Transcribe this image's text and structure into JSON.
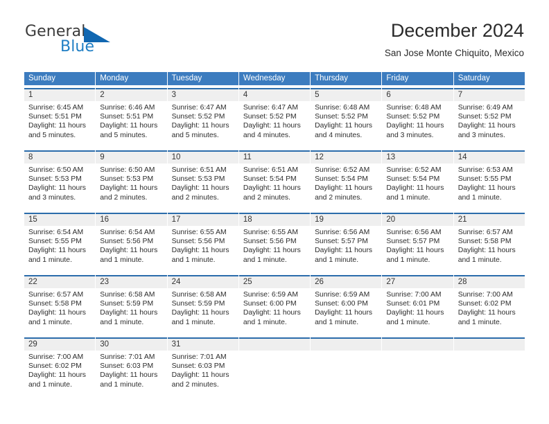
{
  "brand": {
    "name_part1": "General",
    "name_part2": "Blue",
    "triangle_color": "#1167b1",
    "blue_color": "#1f7ec4"
  },
  "header": {
    "title": "December 2024",
    "subtitle": "San Jose Monte Chiquito, Mexico"
  },
  "theme": {
    "header_blue": "#3c7cbf",
    "cell_border_blue": "#2b6cab",
    "daynum_band": "#efefef"
  },
  "weekday_headers": [
    "Sunday",
    "Monday",
    "Tuesday",
    "Wednesday",
    "Thursday",
    "Friday",
    "Saturday"
  ],
  "weeks": [
    [
      {
        "day": "1",
        "sunrise": "Sunrise: 6:45 AM",
        "sunset": "Sunset: 5:51 PM",
        "daylight_line1": "Daylight: 11 hours",
        "daylight_line2": "and 5 minutes."
      },
      {
        "day": "2",
        "sunrise": "Sunrise: 6:46 AM",
        "sunset": "Sunset: 5:51 PM",
        "daylight_line1": "Daylight: 11 hours",
        "daylight_line2": "and 5 minutes."
      },
      {
        "day": "3",
        "sunrise": "Sunrise: 6:47 AM",
        "sunset": "Sunset: 5:52 PM",
        "daylight_line1": "Daylight: 11 hours",
        "daylight_line2": "and 5 minutes."
      },
      {
        "day": "4",
        "sunrise": "Sunrise: 6:47 AM",
        "sunset": "Sunset: 5:52 PM",
        "daylight_line1": "Daylight: 11 hours",
        "daylight_line2": "and 4 minutes."
      },
      {
        "day": "5",
        "sunrise": "Sunrise: 6:48 AM",
        "sunset": "Sunset: 5:52 PM",
        "daylight_line1": "Daylight: 11 hours",
        "daylight_line2": "and 4 minutes."
      },
      {
        "day": "6",
        "sunrise": "Sunrise: 6:48 AM",
        "sunset": "Sunset: 5:52 PM",
        "daylight_line1": "Daylight: 11 hours",
        "daylight_line2": "and 3 minutes."
      },
      {
        "day": "7",
        "sunrise": "Sunrise: 6:49 AM",
        "sunset": "Sunset: 5:52 PM",
        "daylight_line1": "Daylight: 11 hours",
        "daylight_line2": "and 3 minutes."
      }
    ],
    [
      {
        "day": "8",
        "sunrise": "Sunrise: 6:50 AM",
        "sunset": "Sunset: 5:53 PM",
        "daylight_line1": "Daylight: 11 hours",
        "daylight_line2": "and 3 minutes."
      },
      {
        "day": "9",
        "sunrise": "Sunrise: 6:50 AM",
        "sunset": "Sunset: 5:53 PM",
        "daylight_line1": "Daylight: 11 hours",
        "daylight_line2": "and 2 minutes."
      },
      {
        "day": "10",
        "sunrise": "Sunrise: 6:51 AM",
        "sunset": "Sunset: 5:53 PM",
        "daylight_line1": "Daylight: 11 hours",
        "daylight_line2": "and 2 minutes."
      },
      {
        "day": "11",
        "sunrise": "Sunrise: 6:51 AM",
        "sunset": "Sunset: 5:54 PM",
        "daylight_line1": "Daylight: 11 hours",
        "daylight_line2": "and 2 minutes."
      },
      {
        "day": "12",
        "sunrise": "Sunrise: 6:52 AM",
        "sunset": "Sunset: 5:54 PM",
        "daylight_line1": "Daylight: 11 hours",
        "daylight_line2": "and 2 minutes."
      },
      {
        "day": "13",
        "sunrise": "Sunrise: 6:52 AM",
        "sunset": "Sunset: 5:54 PM",
        "daylight_line1": "Daylight: 11 hours",
        "daylight_line2": "and 1 minute."
      },
      {
        "day": "14",
        "sunrise": "Sunrise: 6:53 AM",
        "sunset": "Sunset: 5:55 PM",
        "daylight_line1": "Daylight: 11 hours",
        "daylight_line2": "and 1 minute."
      }
    ],
    [
      {
        "day": "15",
        "sunrise": "Sunrise: 6:54 AM",
        "sunset": "Sunset: 5:55 PM",
        "daylight_line1": "Daylight: 11 hours",
        "daylight_line2": "and 1 minute."
      },
      {
        "day": "16",
        "sunrise": "Sunrise: 6:54 AM",
        "sunset": "Sunset: 5:56 PM",
        "daylight_line1": "Daylight: 11 hours",
        "daylight_line2": "and 1 minute."
      },
      {
        "day": "17",
        "sunrise": "Sunrise: 6:55 AM",
        "sunset": "Sunset: 5:56 PM",
        "daylight_line1": "Daylight: 11 hours",
        "daylight_line2": "and 1 minute."
      },
      {
        "day": "18",
        "sunrise": "Sunrise: 6:55 AM",
        "sunset": "Sunset: 5:56 PM",
        "daylight_line1": "Daylight: 11 hours",
        "daylight_line2": "and 1 minute."
      },
      {
        "day": "19",
        "sunrise": "Sunrise: 6:56 AM",
        "sunset": "Sunset: 5:57 PM",
        "daylight_line1": "Daylight: 11 hours",
        "daylight_line2": "and 1 minute."
      },
      {
        "day": "20",
        "sunrise": "Sunrise: 6:56 AM",
        "sunset": "Sunset: 5:57 PM",
        "daylight_line1": "Daylight: 11 hours",
        "daylight_line2": "and 1 minute."
      },
      {
        "day": "21",
        "sunrise": "Sunrise: 6:57 AM",
        "sunset": "Sunset: 5:58 PM",
        "daylight_line1": "Daylight: 11 hours",
        "daylight_line2": "and 1 minute."
      }
    ],
    [
      {
        "day": "22",
        "sunrise": "Sunrise: 6:57 AM",
        "sunset": "Sunset: 5:58 PM",
        "daylight_line1": "Daylight: 11 hours",
        "daylight_line2": "and 1 minute."
      },
      {
        "day": "23",
        "sunrise": "Sunrise: 6:58 AM",
        "sunset": "Sunset: 5:59 PM",
        "daylight_line1": "Daylight: 11 hours",
        "daylight_line2": "and 1 minute."
      },
      {
        "day": "24",
        "sunrise": "Sunrise: 6:58 AM",
        "sunset": "Sunset: 5:59 PM",
        "daylight_line1": "Daylight: 11 hours",
        "daylight_line2": "and 1 minute."
      },
      {
        "day": "25",
        "sunrise": "Sunrise: 6:59 AM",
        "sunset": "Sunset: 6:00 PM",
        "daylight_line1": "Daylight: 11 hours",
        "daylight_line2": "and 1 minute."
      },
      {
        "day": "26",
        "sunrise": "Sunrise: 6:59 AM",
        "sunset": "Sunset: 6:00 PM",
        "daylight_line1": "Daylight: 11 hours",
        "daylight_line2": "and 1 minute."
      },
      {
        "day": "27",
        "sunrise": "Sunrise: 7:00 AM",
        "sunset": "Sunset: 6:01 PM",
        "daylight_line1": "Daylight: 11 hours",
        "daylight_line2": "and 1 minute."
      },
      {
        "day": "28",
        "sunrise": "Sunrise: 7:00 AM",
        "sunset": "Sunset: 6:02 PM",
        "daylight_line1": "Daylight: 11 hours",
        "daylight_line2": "and 1 minute."
      }
    ],
    [
      {
        "day": "29",
        "sunrise": "Sunrise: 7:00 AM",
        "sunset": "Sunset: 6:02 PM",
        "daylight_line1": "Daylight: 11 hours",
        "daylight_line2": "and 1 minute."
      },
      {
        "day": "30",
        "sunrise": "Sunrise: 7:01 AM",
        "sunset": "Sunset: 6:03 PM",
        "daylight_line1": "Daylight: 11 hours",
        "daylight_line2": "and 1 minute."
      },
      {
        "day": "31",
        "sunrise": "Sunrise: 7:01 AM",
        "sunset": "Sunset: 6:03 PM",
        "daylight_line1": "Daylight: 11 hours",
        "daylight_line2": "and 2 minutes."
      },
      {
        "day": "",
        "sunrise": "",
        "sunset": "",
        "daylight_line1": "",
        "daylight_line2": ""
      },
      {
        "day": "",
        "sunrise": "",
        "sunset": "",
        "daylight_line1": "",
        "daylight_line2": ""
      },
      {
        "day": "",
        "sunrise": "",
        "sunset": "",
        "daylight_line1": "",
        "daylight_line2": ""
      },
      {
        "day": "",
        "sunrise": "",
        "sunset": "",
        "daylight_line1": "",
        "daylight_line2": ""
      }
    ]
  ]
}
